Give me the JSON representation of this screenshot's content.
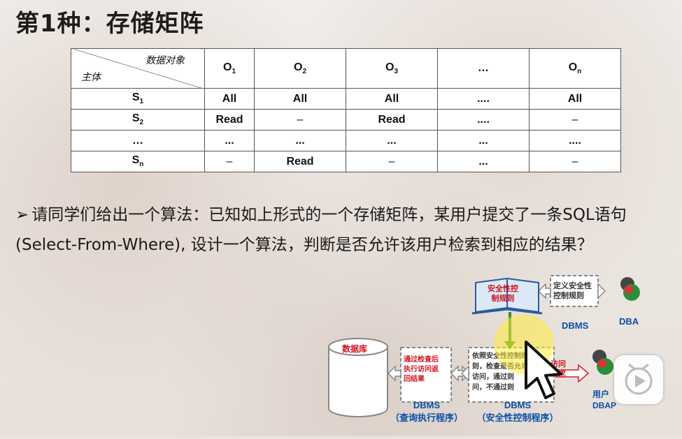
{
  "slide": {
    "title": "第1种：存储矩阵"
  },
  "matrix": {
    "corner_top": "数据对象",
    "corner_bottom": "主体",
    "col_headers": [
      "O",
      "O",
      "O",
      "…",
      "O"
    ],
    "col_subs": [
      "1",
      "2",
      "3",
      "",
      "n"
    ],
    "rows": [
      {
        "head": "S",
        "sub": "1",
        "cells": [
          "All",
          "All",
          "All",
          "....",
          "All"
        ]
      },
      {
        "head": "S",
        "sub": "2",
        "cells": [
          "Read",
          "–",
          "Read",
          "....",
          "–"
        ]
      },
      {
        "head": "…",
        "sub": "",
        "cells": [
          "...",
          "...",
          "...",
          "...",
          "...."
        ]
      },
      {
        "head": "S",
        "sub": "n",
        "cells": [
          "–",
          "Read",
          "–",
          "...",
          "–"
        ]
      }
    ]
  },
  "question": {
    "bullet": "➢",
    "text": "请同学们给出一个算法：已知如上形式的一个存储矩阵，某用户提交了一条SQL语句(Select-From-Where), 设计一个算法，判断是否允许该用户检索到相应的结果？"
  },
  "diagram": {
    "book_text_1": "安全性控",
    "book_text_2": "制规则",
    "define_rule_1": "定义安全性",
    "define_rule_2": "控制规则",
    "dbms_top": "DBMS",
    "dba": "DBA",
    "database": "数据库",
    "pass_check_1": "通过检查后",
    "pass_check_2": "执行访问返",
    "pass_check_3": "回结果",
    "check_1": "依照安全性控制规",
    "check_2": "则，检查是否允许",
    "check_3": "访问，通过则",
    "check_4": "问，不通过则",
    "access_req": "访问",
    "access_req2": "请求",
    "dbms_left": "DBMS",
    "dbms_left_sub": "（查询执行程序）",
    "dbms_mid": "DBMS",
    "dbms_mid_sub": "（安全性控制程序）",
    "user": "用户",
    "dbap": "DBAP"
  },
  "colors": {
    "blue_label": "#0b4fa8",
    "red_label": "#d0121f",
    "title": "#1c1c1c"
  },
  "icons": {
    "play": "play-icon",
    "cursor": "mouse-pointer-icon"
  }
}
